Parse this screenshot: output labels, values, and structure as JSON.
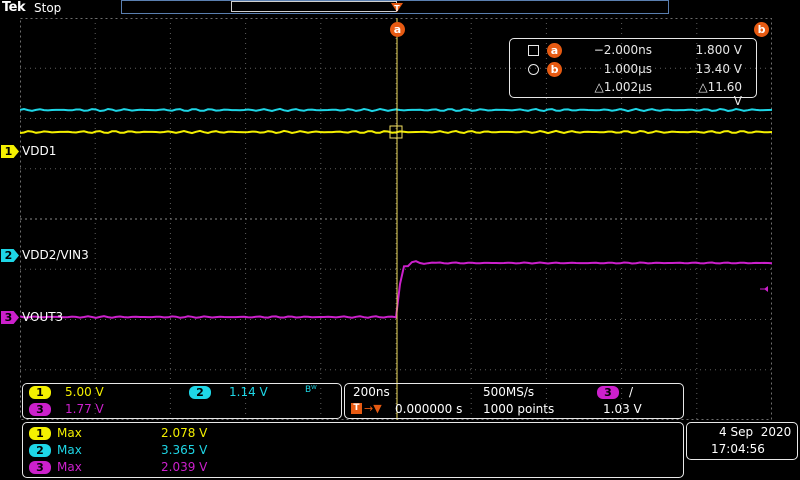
{
  "header": {
    "brand": "Tek",
    "status": "Stop"
  },
  "cursors": {
    "a": {
      "label": "a",
      "time": "−2.000ns",
      "value": "1.800 V"
    },
    "b": {
      "label": "b",
      "time": "1.000μs",
      "value": "13.40 V"
    },
    "delta": {
      "time": "△1.002μs",
      "value": "△11.60 V"
    }
  },
  "channels": [
    {
      "num": "1",
      "name": "VDD1",
      "color": "#f4f000"
    },
    {
      "num": "2",
      "name": "VDD2/VIN3",
      "color": "#1ed6e6"
    },
    {
      "num": "3",
      "name": "VOUT3",
      "color": "#cc20cc"
    }
  ],
  "vertical": {
    "ch1_scale": "5.00 V",
    "ch2_scale": "1.14 V",
    "ch2_bw": "Bᵂ",
    "ch3_scale": "1.77 V"
  },
  "horizontal": {
    "time_div": "200ns",
    "sample_rate": "500MS/s",
    "trigger_ch": "3",
    "trigger_slope": "/",
    "trigger_pos": "0.000000 s",
    "record_length": "1000 points",
    "trigger_level": "1.03 V"
  },
  "measurements": [
    {
      "ch": "1",
      "type": "Max",
      "value": "2.078 V"
    },
    {
      "ch": "2",
      "type": "Max",
      "value": "3.365 V"
    },
    {
      "ch": "3",
      "type": "Max",
      "value": "2.039 V"
    }
  ],
  "datetime": {
    "date": "4 Sep  2020",
    "time": "17:04:56"
  },
  "trigger_marker": "T",
  "cursor_marker_a": "a",
  "cursor_marker_b": "b"
}
